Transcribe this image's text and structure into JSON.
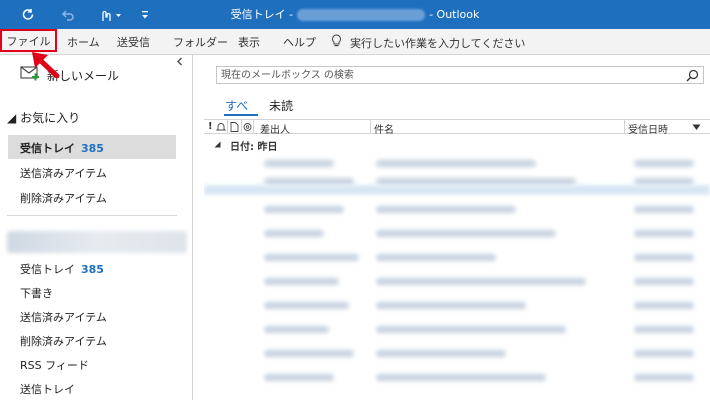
{
  "titlebar": {
    "title_prefix": "受信トレイ -",
    "title_suffix": "- Outlook",
    "colors": {
      "background": "#1f6fbf"
    },
    "quick_access": [
      "refresh-icon",
      "undo-icon",
      "touch-mode-icon",
      "customize-icon"
    ]
  },
  "ribbon": {
    "tabs": {
      "file": "ファイル",
      "home": "ホーム",
      "send_receive": "送受信",
      "folder": "フォルダー",
      "view": "表示",
      "help": "ヘルプ"
    },
    "tellme": "実行したい作業を入力してください",
    "highlight_color": "#e0001a"
  },
  "leftnav": {
    "new_mail": "新しいメール",
    "favorites_header": "お気に入り",
    "favorites": {
      "inbox": {
        "label": "受信トレイ",
        "count": "385"
      },
      "sent": "送信済みアイテム",
      "deleted": "削除済みアイテム"
    },
    "account": {
      "inbox": {
        "label": "受信トレイ",
        "count": "385"
      },
      "drafts": "下書き",
      "sent": "送信済みアイテム",
      "deleted": "削除済みアイテム",
      "rss": "RSS フィード",
      "outbox": "送信トレイ"
    },
    "count_color": "#1f6fbf"
  },
  "main": {
    "search": {
      "placeholder": "現在のメールボックス の検索"
    },
    "filters": {
      "all": "すべ",
      "unread": "未読"
    },
    "columns": {
      "importance": "!",
      "from": "差出人",
      "subject": "件名",
      "received": "受信日時"
    },
    "group_label": "日付: 昨日"
  }
}
